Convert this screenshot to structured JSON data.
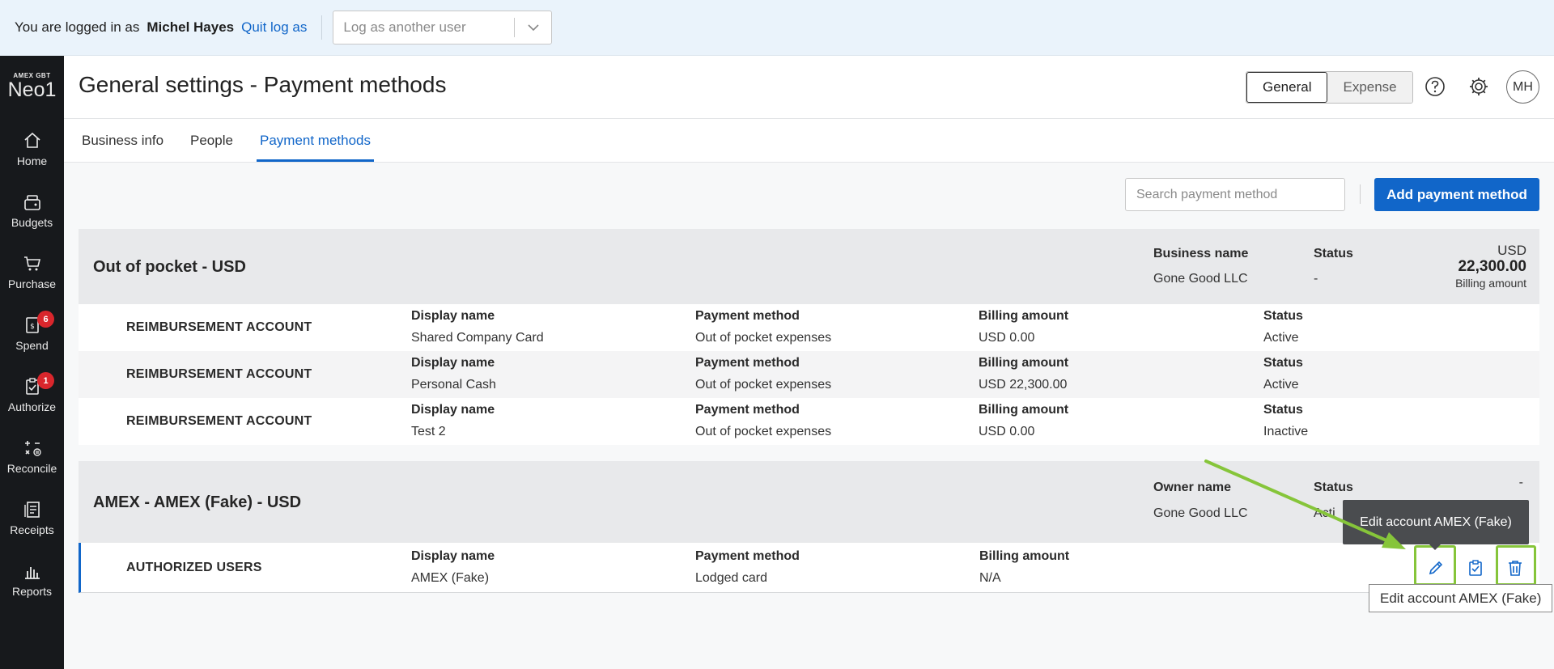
{
  "impersonation": {
    "logged_in_text": "You are logged in as",
    "user_name": "Michel Hayes",
    "quit_label": "Quit log as",
    "select_placeholder": "Log as another user"
  },
  "brand": {
    "small": "AMEX GBT",
    "big": "Neo1"
  },
  "nav": {
    "items": [
      {
        "label": "Home",
        "icon": "home-icon"
      },
      {
        "label": "Budgets",
        "icon": "budgets-icon"
      },
      {
        "label": "Purchase",
        "icon": "cart-icon"
      },
      {
        "label": "Spend",
        "icon": "spend-icon",
        "badge": "6"
      },
      {
        "label": "Authorize",
        "icon": "authorize-icon",
        "badge": "1"
      },
      {
        "label": "Reconcile",
        "icon": "reconcile-icon"
      },
      {
        "label": "Receipts",
        "icon": "receipts-icon"
      },
      {
        "label": "Reports",
        "icon": "reports-icon"
      }
    ]
  },
  "header": {
    "title": "General settings - Payment methods",
    "toggle": {
      "general": "General",
      "expense": "Expense",
      "selected": "General"
    },
    "avatar_initials": "MH"
  },
  "tabs": [
    {
      "label": "Business info",
      "active": false
    },
    {
      "label": "People",
      "active": false
    },
    {
      "label": "Payment methods",
      "active": true
    }
  ],
  "toolbar": {
    "search_placeholder": "Search payment method",
    "add_label": "Add payment method"
  },
  "groups": [
    {
      "title": "Out of pocket - USD",
      "business_name_label": "Business name",
      "business_name": "Gone Good LLC",
      "status_label": "Status",
      "status": "-",
      "currency": "USD",
      "amount": "22,300.00",
      "amount_label": "Billing amount",
      "rows": [
        {
          "type": "REIMBURSEMENT ACCOUNT",
          "display_name_label": "Display name",
          "display_name": "Shared Company Card",
          "payment_method_label": "Payment method",
          "payment_method": "Out of pocket expenses",
          "billing_label": "Billing amount",
          "billing": "USD 0.00",
          "status_label": "Status",
          "status": "Active"
        },
        {
          "type": "REIMBURSEMENT ACCOUNT",
          "display_name_label": "Display name",
          "display_name": "Personal Cash",
          "payment_method_label": "Payment method",
          "payment_method": "Out of pocket expenses",
          "billing_label": "Billing amount",
          "billing": "USD 22,300.00",
          "status_label": "Status",
          "status": "Active"
        },
        {
          "type": "REIMBURSEMENT ACCOUNT",
          "display_name_label": "Display name",
          "display_name": "Test 2",
          "payment_method_label": "Payment method",
          "payment_method": "Out of pocket expenses",
          "billing_label": "Billing amount",
          "billing": "USD 0.00",
          "status_label": "Status",
          "status": "Inactive"
        }
      ]
    },
    {
      "title": "AMEX - AMEX (Fake) - USD",
      "owner_name_label": "Owner name",
      "owner_name": "Gone Good LLC",
      "status_label": "Status",
      "status_partial": "Acti",
      "right_dash": "-",
      "rows": [
        {
          "type": "AUTHORIZED USERS",
          "display_name_label": "Display name",
          "display_name": "AMEX (Fake)",
          "payment_method_label": "Payment method",
          "payment_method": "Lodged card",
          "billing_label": "Billing amount",
          "billing": "N/A"
        }
      ]
    }
  ],
  "tooltips": {
    "dark": "Edit account AMEX (Fake)",
    "light": "Edit account AMEX (Fake)"
  },
  "colors": {
    "accent": "#1166c9",
    "highlight": "#86c53a",
    "nav_bg": "#17191c",
    "badge": "#d9262c"
  }
}
